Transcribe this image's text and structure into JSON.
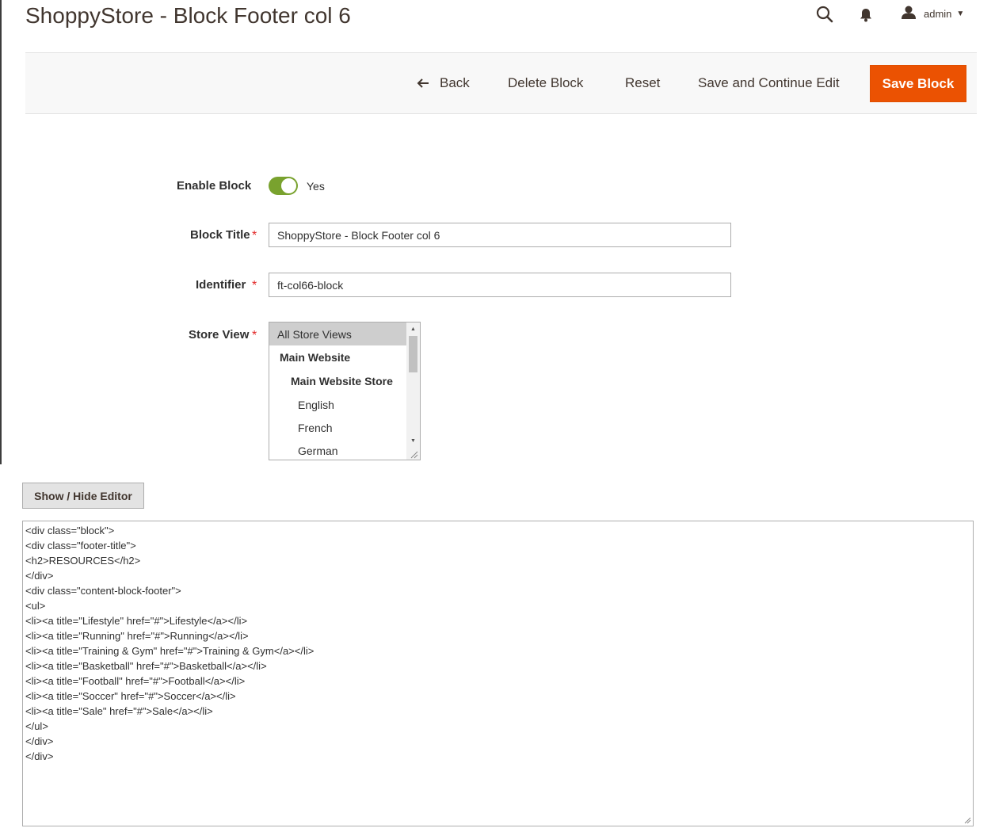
{
  "header": {
    "title": "ShoppyStore - Block Footer col 6",
    "search_icon": "search-icon",
    "notifications_icon": "bell-icon",
    "user": {
      "icon": "user-icon",
      "name": "admin"
    }
  },
  "actions": {
    "back_label": "Back",
    "delete_label": "Delete Block",
    "reset_label": "Reset",
    "save_continue_label": "Save and Continue Edit",
    "save_label": "Save Block",
    "accent_color": "#eb5202"
  },
  "form": {
    "enable": {
      "label": "Enable Block",
      "value": "Yes",
      "enabled": true,
      "color": "#79a22e"
    },
    "title": {
      "label": "Block Title",
      "value": "ShoppyStore - Block Footer col 6"
    },
    "identifier": {
      "label": "Identifier",
      "value": "ft-col66-block"
    },
    "store_view": {
      "label": "Store View",
      "options": [
        {
          "label": "All Store Views",
          "selected": true
        },
        {
          "label": "Main Website"
        },
        {
          "label": "Main Website Store"
        },
        {
          "label": "English"
        },
        {
          "label": "French"
        },
        {
          "label": "German"
        }
      ]
    },
    "required_mark": "*"
  },
  "editor": {
    "toggle_label": "Show / Hide Editor",
    "content_lines": [
      "<div class=\"block\">",
      "<div class=\"footer-title\">",
      "<h2>RESOURCES</h2>",
      "</div>",
      "<div class=\"content-block-footer\">",
      "<ul>",
      "<li><a title=\"Lifestyle\" href=\"#\">Lifestyle</a></li>",
      "<li><a title=\"Running\" href=\"#\">Running</a></li>",
      "<li><a title=\"Training & Gym\" href=\"#\">Training & Gym</a></li>",
      "<li><a title=\"Basketball\" href=\"#\">Basketball</a></li>",
      "<li><a title=\"Football\" href=\"#\">Football</a></li>",
      "<li><a title=\"Soccer\" href=\"#\">Soccer</a></li>",
      "<li><a title=\"Sale\" href=\"#\">Sale</a></li>",
      "</ul>",
      "</div>",
      "</div>"
    ]
  }
}
